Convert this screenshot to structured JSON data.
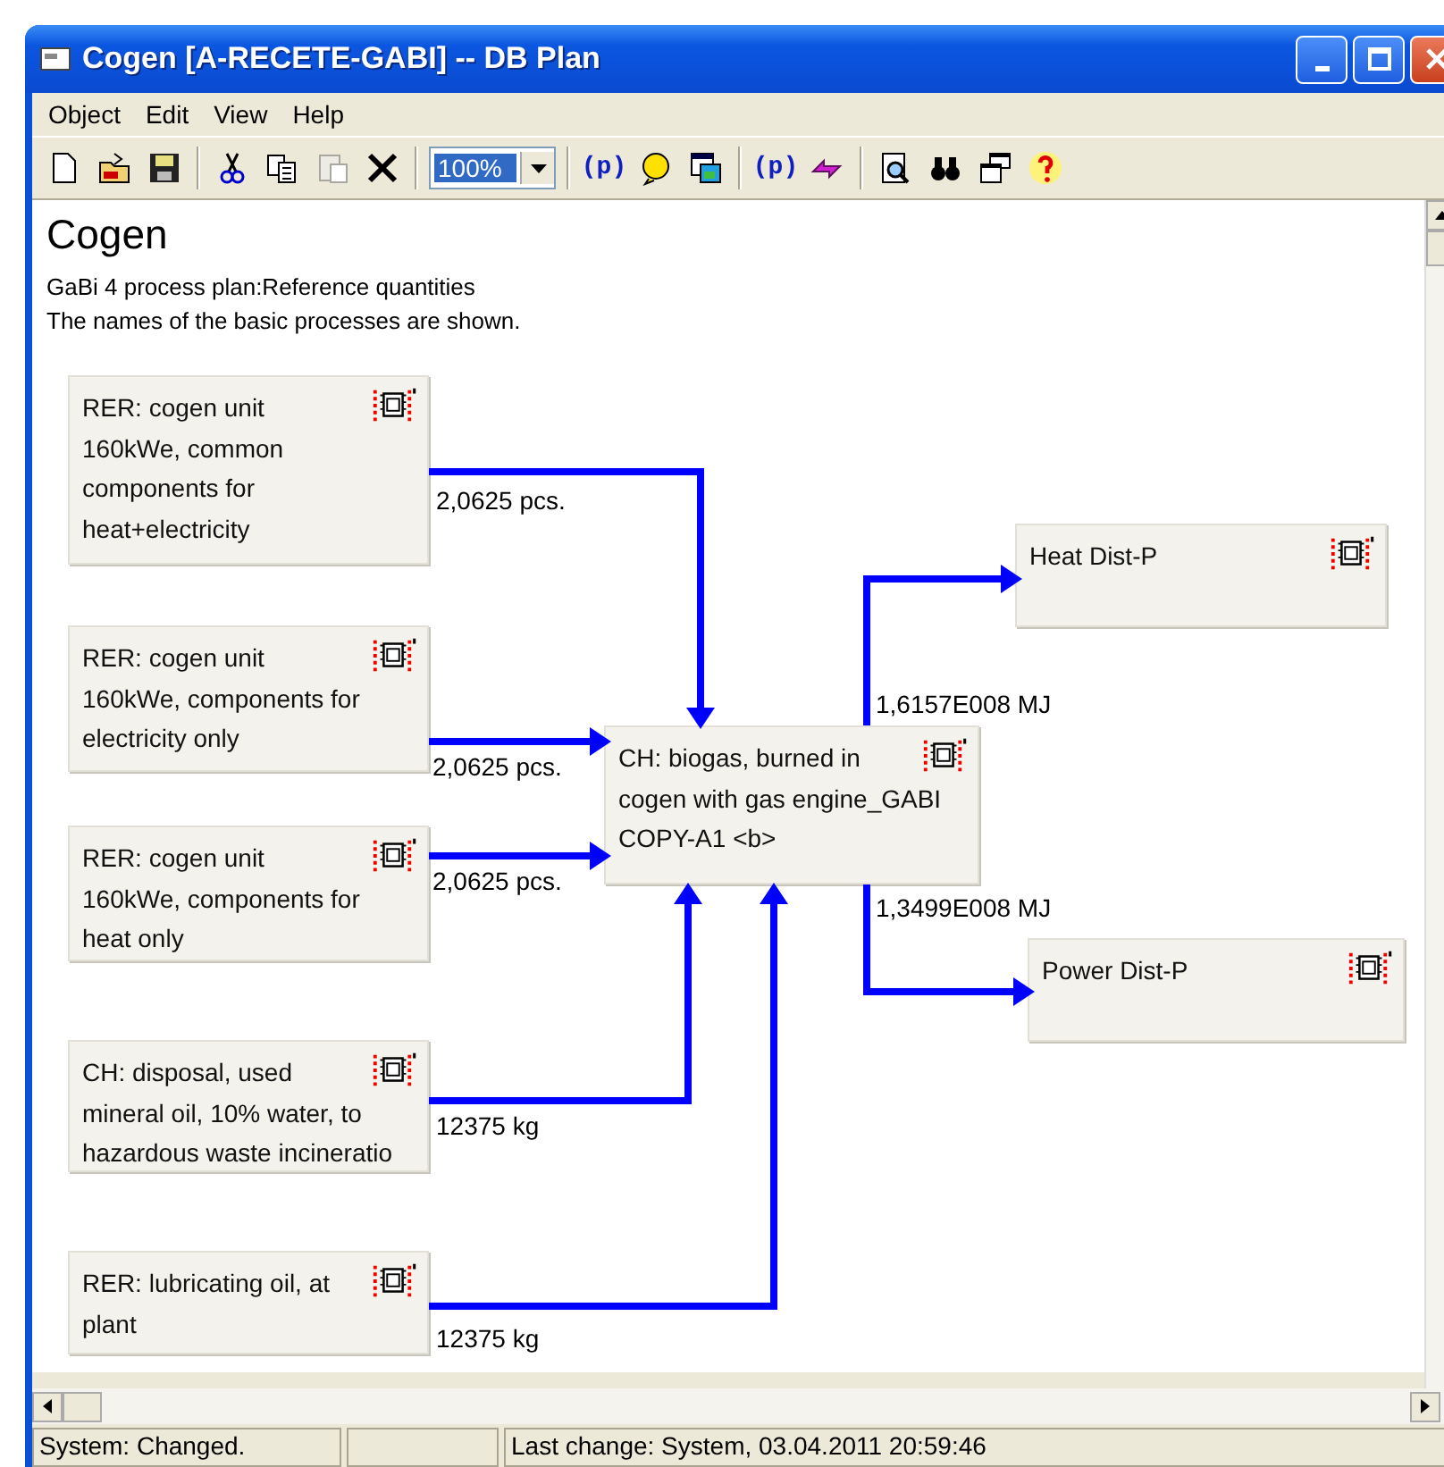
{
  "window": {
    "title": "Cogen [A-RECETE-GABI] -- DB Plan"
  },
  "menu": [
    {
      "label": "Object"
    },
    {
      "label": "Edit"
    },
    {
      "label": "View"
    },
    {
      "label": "Help"
    }
  ],
  "toolbar": {
    "paste_disabled": true,
    "zoom": "100%",
    "glyphs": [
      "(p)",
      "(p)"
    ]
  },
  "document": {
    "title": "Cogen",
    "description": [
      "GaBi 4 process plan:Reference quantities",
      "The names of the basic processes are shown."
    ]
  },
  "diagram": {
    "nodes": [
      {
        "name": "RER: cogen unit\n160kWe, common\ncomponents for\nheat+electricity"
      },
      {
        "name": "RER: cogen unit\n160kWe, components for\nelectricity only"
      },
      {
        "name": "RER: cogen unit\n160kWe, components for\nheat only"
      },
      {
        "name": "CH: disposal, used\nmineral oil, 10% water, to\nhazardous waste incineratio"
      },
      {
        "name": "RER: lubricating oil, at\nplant"
      },
      {
        "name": "CH: biogas, burned in\ncogen with gas engine_GABI\nCOPY-A1 <b>"
      },
      {
        "name": "Heat Dist-P"
      },
      {
        "name": "Power Dist-P"
      }
    ],
    "flows": [
      {
        "label": "2,0625 pcs."
      },
      {
        "label": "2,0625 pcs."
      },
      {
        "label": "2,0625 pcs."
      },
      {
        "label": "12375 kg"
      },
      {
        "label": "12375 kg"
      },
      {
        "label": "1,6157E008 MJ"
      },
      {
        "label": "1,3499E008 MJ"
      }
    ]
  },
  "status_bar": [
    "System: Changed.",
    "Last change: System, 03.04.2011 20:59:46"
  ]
}
